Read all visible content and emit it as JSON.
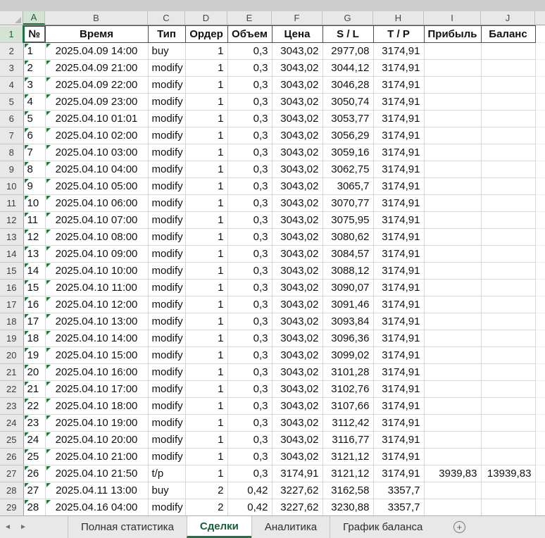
{
  "sheet": {
    "column_letters": [
      "A",
      "B",
      "C",
      "D",
      "E",
      "F",
      "G",
      "H",
      "I",
      "J"
    ],
    "header_cells": [
      "№",
      "Время",
      "Тип",
      "Ордер",
      "Объем",
      "Цена",
      "S / L",
      "T / P",
      "Прибыль",
      "Баланс"
    ],
    "data_rows": [
      [
        "1",
        "2025.04.09 14:00",
        "buy",
        "1",
        "0,3",
        "3043,02",
        "2977,08",
        "3174,91",
        "",
        ""
      ],
      [
        "2",
        "2025.04.09 21:00",
        "modify",
        "1",
        "0,3",
        "3043,02",
        "3044,12",
        "3174,91",
        "",
        ""
      ],
      [
        "3",
        "2025.04.09 22:00",
        "modify",
        "1",
        "0,3",
        "3043,02",
        "3046,28",
        "3174,91",
        "",
        ""
      ],
      [
        "4",
        "2025.04.09 23:00",
        "modify",
        "1",
        "0,3",
        "3043,02",
        "3050,74",
        "3174,91",
        "",
        ""
      ],
      [
        "5",
        "2025.04.10 01:01",
        "modify",
        "1",
        "0,3",
        "3043,02",
        "3053,77",
        "3174,91",
        "",
        ""
      ],
      [
        "6",
        "2025.04.10 02:00",
        "modify",
        "1",
        "0,3",
        "3043,02",
        "3056,29",
        "3174,91",
        "",
        ""
      ],
      [
        "7",
        "2025.04.10 03:00",
        "modify",
        "1",
        "0,3",
        "3043,02",
        "3059,16",
        "3174,91",
        "",
        ""
      ],
      [
        "8",
        "2025.04.10 04:00",
        "modify",
        "1",
        "0,3",
        "3043,02",
        "3062,75",
        "3174,91",
        "",
        ""
      ],
      [
        "9",
        "2025.04.10 05:00",
        "modify",
        "1",
        "0,3",
        "3043,02",
        "3065,7",
        "3174,91",
        "",
        ""
      ],
      [
        "10",
        "2025.04.10 06:00",
        "modify",
        "1",
        "0,3",
        "3043,02",
        "3070,77",
        "3174,91",
        "",
        ""
      ],
      [
        "11",
        "2025.04.10 07:00",
        "modify",
        "1",
        "0,3",
        "3043,02",
        "3075,95",
        "3174,91",
        "",
        ""
      ],
      [
        "12",
        "2025.04.10 08:00",
        "modify",
        "1",
        "0,3",
        "3043,02",
        "3080,62",
        "3174,91",
        "",
        ""
      ],
      [
        "13",
        "2025.04.10 09:00",
        "modify",
        "1",
        "0,3",
        "3043,02",
        "3084,57",
        "3174,91",
        "",
        ""
      ],
      [
        "14",
        "2025.04.10 10:00",
        "modify",
        "1",
        "0,3",
        "3043,02",
        "3088,12",
        "3174,91",
        "",
        ""
      ],
      [
        "15",
        "2025.04.10 11:00",
        "modify",
        "1",
        "0,3",
        "3043,02",
        "3090,07",
        "3174,91",
        "",
        ""
      ],
      [
        "16",
        "2025.04.10 12:00",
        "modify",
        "1",
        "0,3",
        "3043,02",
        "3091,46",
        "3174,91",
        "",
        ""
      ],
      [
        "17",
        "2025.04.10 13:00",
        "modify",
        "1",
        "0,3",
        "3043,02",
        "3093,84",
        "3174,91",
        "",
        ""
      ],
      [
        "18",
        "2025.04.10 14:00",
        "modify",
        "1",
        "0,3",
        "3043,02",
        "3096,36",
        "3174,91",
        "",
        ""
      ],
      [
        "19",
        "2025.04.10 15:00",
        "modify",
        "1",
        "0,3",
        "3043,02",
        "3099,02",
        "3174,91",
        "",
        ""
      ],
      [
        "20",
        "2025.04.10 16:00",
        "modify",
        "1",
        "0,3",
        "3043,02",
        "3101,28",
        "3174,91",
        "",
        ""
      ],
      [
        "21",
        "2025.04.10 17:00",
        "modify",
        "1",
        "0,3",
        "3043,02",
        "3102,76",
        "3174,91",
        "",
        ""
      ],
      [
        "22",
        "2025.04.10 18:00",
        "modify",
        "1",
        "0,3",
        "3043,02",
        "3107,66",
        "3174,91",
        "",
        ""
      ],
      [
        "23",
        "2025.04.10 19:00",
        "modify",
        "1",
        "0,3",
        "3043,02",
        "3112,42",
        "3174,91",
        "",
        ""
      ],
      [
        "24",
        "2025.04.10 20:00",
        "modify",
        "1",
        "0,3",
        "3043,02",
        "3116,77",
        "3174,91",
        "",
        ""
      ],
      [
        "25",
        "2025.04.10 21:00",
        "modify",
        "1",
        "0,3",
        "3043,02",
        "3121,12",
        "3174,91",
        "",
        ""
      ],
      [
        "26",
        "2025.04.10 21:50",
        "t/p",
        "1",
        "0,3",
        "3174,91",
        "3121,12",
        "3174,91",
        "3939,83",
        "13939,83"
      ],
      [
        "27",
        "2025.04.11 13:00",
        "buy",
        "2",
        "0,42",
        "3227,62",
        "3162,58",
        "3357,7",
        "",
        ""
      ],
      [
        "28",
        "2025.04.16 04:00",
        "modify",
        "2",
        "0,42",
        "3227,62",
        "3230,88",
        "3357,7",
        "",
        ""
      ]
    ],
    "selection": {
      "column": "A",
      "row": 1
    }
  },
  "tabs": {
    "nav_left_icon": "◄",
    "nav_right_icon": "►",
    "items": [
      {
        "label": "Полная статистика",
        "active": false
      },
      {
        "label": "Сделки",
        "active": true
      },
      {
        "label": "Аналитика",
        "active": false
      },
      {
        "label": "График баланса",
        "active": false
      }
    ],
    "add_sheet_icon": "+"
  },
  "colors": {
    "accent_green": "#217346",
    "error_indicator_green": "#1d7d36",
    "header_gray": "#e8e8e8"
  }
}
